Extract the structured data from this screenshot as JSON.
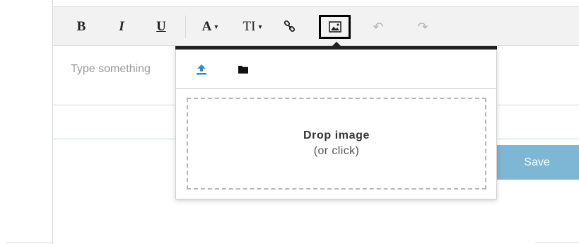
{
  "toolbar": {
    "bold": "B",
    "italic": "I",
    "underline": "U",
    "font_color": "A",
    "font_size": "TI",
    "dropdown_caret": "▾",
    "undo": "↶",
    "redo": "↷"
  },
  "editor": {
    "placeholder": "Type something"
  },
  "save_label": "Save",
  "image_popover": {
    "tabs": [
      "upload-icon",
      "folder-icon"
    ],
    "drop_title": "Drop image",
    "drop_subtitle": "(or click)"
  },
  "colors": {
    "accent": "#2a8ad4",
    "save_button": "#7eb6d6",
    "toolbar_bg": "#f2f2f2"
  },
  "icons": {
    "link": "link-icon",
    "image": "image-icon",
    "undo": "undo-icon",
    "redo": "redo-icon"
  }
}
